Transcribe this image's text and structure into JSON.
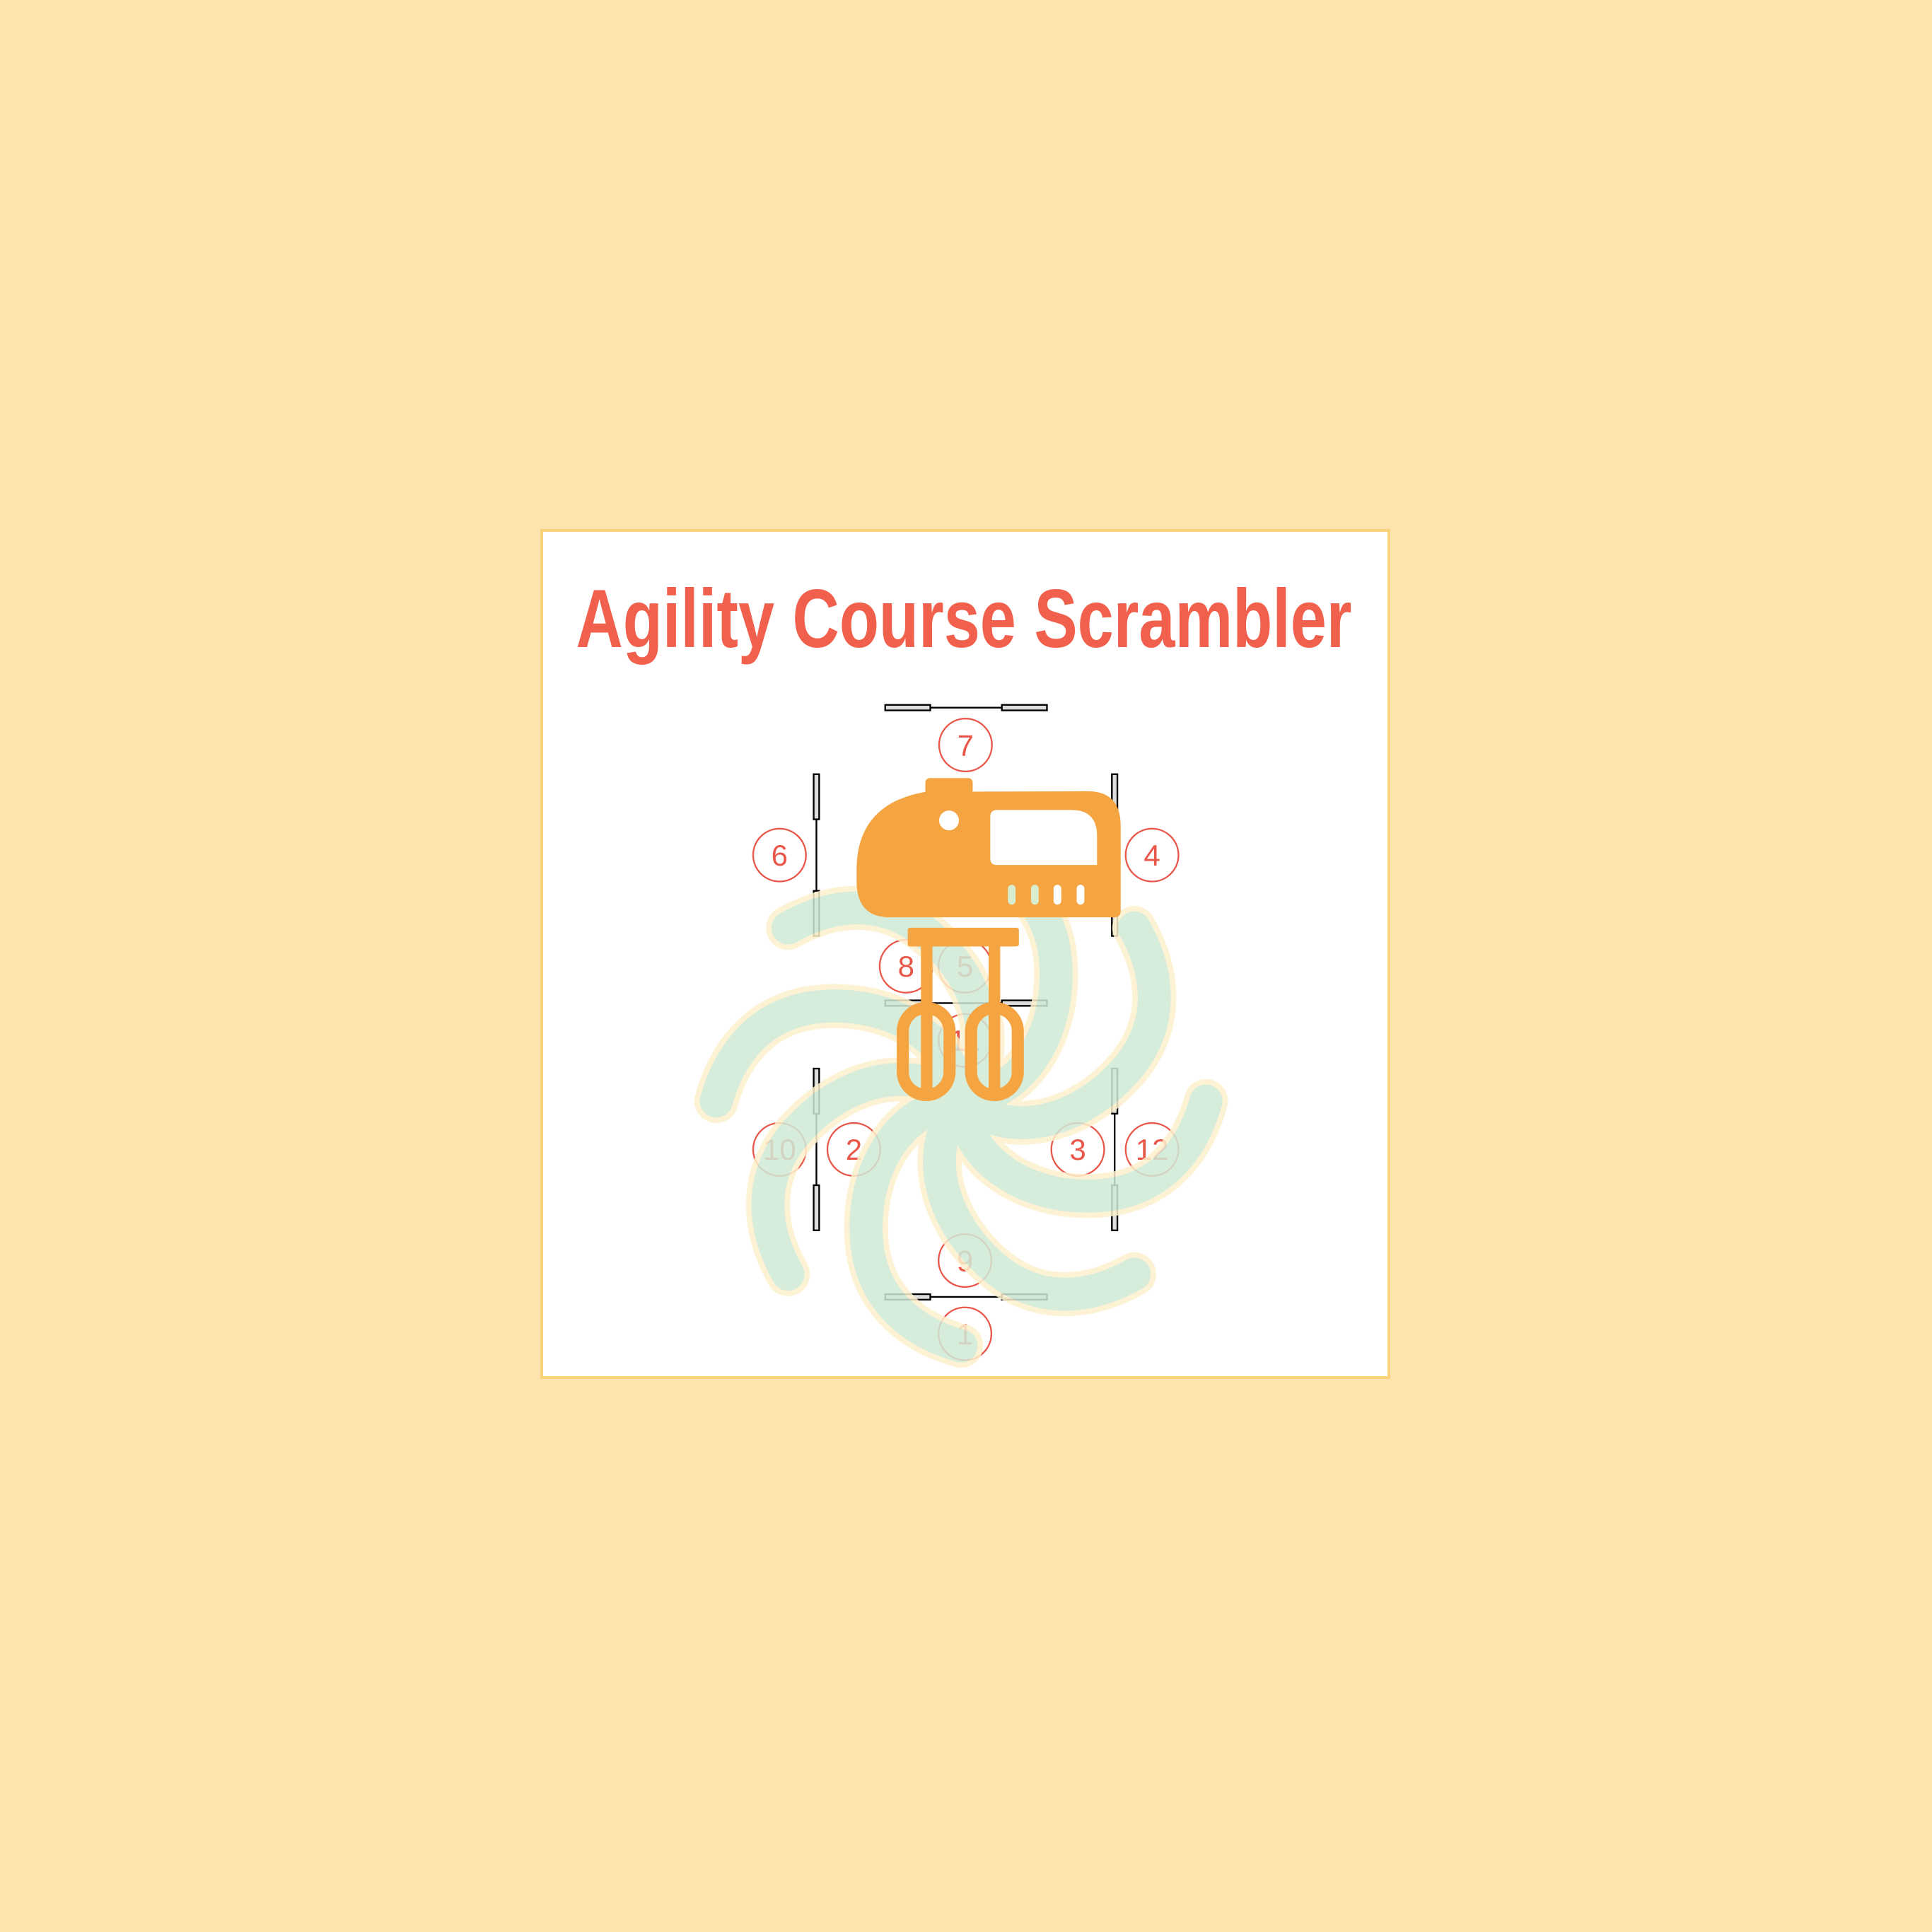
{
  "title": "Agility Course Scrambler",
  "colors": {
    "background": "#fde4ae",
    "card_border": "#f9d37a",
    "title": "#f0604d",
    "mixer": "#f5a442",
    "swirl": "#cfead6",
    "swirl_outline": "#fdf0cc",
    "marker": "#e8574a"
  },
  "icons": [
    "hand-mixer-icon",
    "swirl-icon",
    "jump-obstacle-icon"
  ],
  "course_markers": [
    "7",
    "6",
    "4",
    "8",
    "5",
    "11",
    "10",
    "2",
    "3",
    "12",
    "9",
    "1"
  ]
}
